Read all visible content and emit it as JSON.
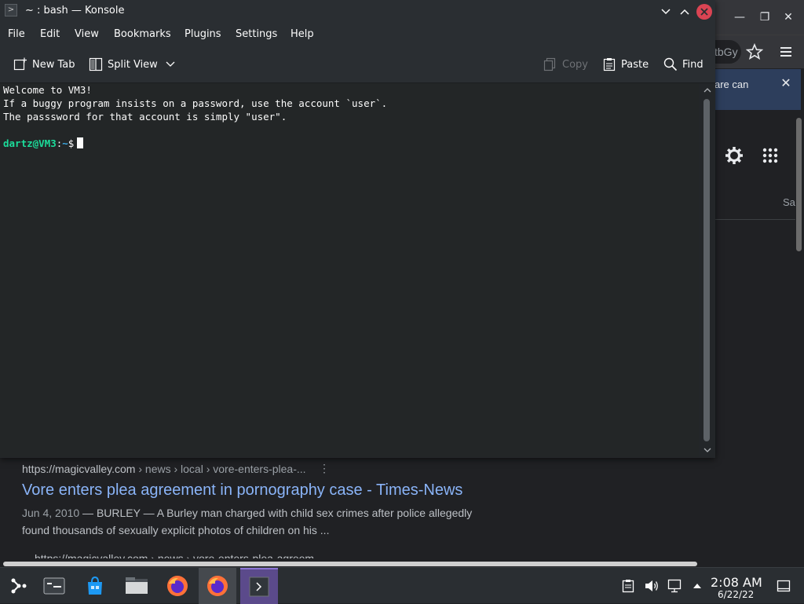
{
  "browser": {
    "url_fragment": "tbGy",
    "banner_text": "are can",
    "page_tab_fragment": "Sa",
    "result": {
      "url_domain": "https://magicvalley.com",
      "url_path": " › news › local › vore-enters-plea-...",
      "menu_glyph": "⋮",
      "title": "Vore enters plea agreement in pornography case - Times-News",
      "date": "Jun 4, 2010",
      "snippet": " — BURLEY — A Burley man charged with child sex crimes after police allegedly found thousands of sexually explicit photos of children on his ..."
    },
    "result2_url": "https://magicvalley.com › news › vore-enters-plea-agreem..."
  },
  "konsole": {
    "title": "~ : bash — Konsole",
    "menu": [
      "File",
      "Edit",
      "View",
      "Bookmarks",
      "Plugins",
      "Settings",
      "Help"
    ],
    "toolbar": {
      "new_tab": "New Tab",
      "split_view": "Split View",
      "copy": "Copy",
      "paste": "Paste",
      "find": "Find"
    },
    "terminal": {
      "lines": [
        "Welcome to VM3!",
        "If a buggy program insists on a password, use the account `user`.",
        "The passsword for that account is simply \"user\"."
      ],
      "prompt_user": "dartz@VM3",
      "prompt_sep": ":",
      "prompt_path": "~",
      "prompt_symbol": "$"
    }
  },
  "taskbar": {
    "clock_time": "2:08 AM",
    "clock_date": "6/22/22"
  },
  "colors": {
    "prompt_user": "#1cdc9a",
    "prompt_path": "#3daee9",
    "link": "#8ab4f8",
    "close_button": "#da4453"
  }
}
